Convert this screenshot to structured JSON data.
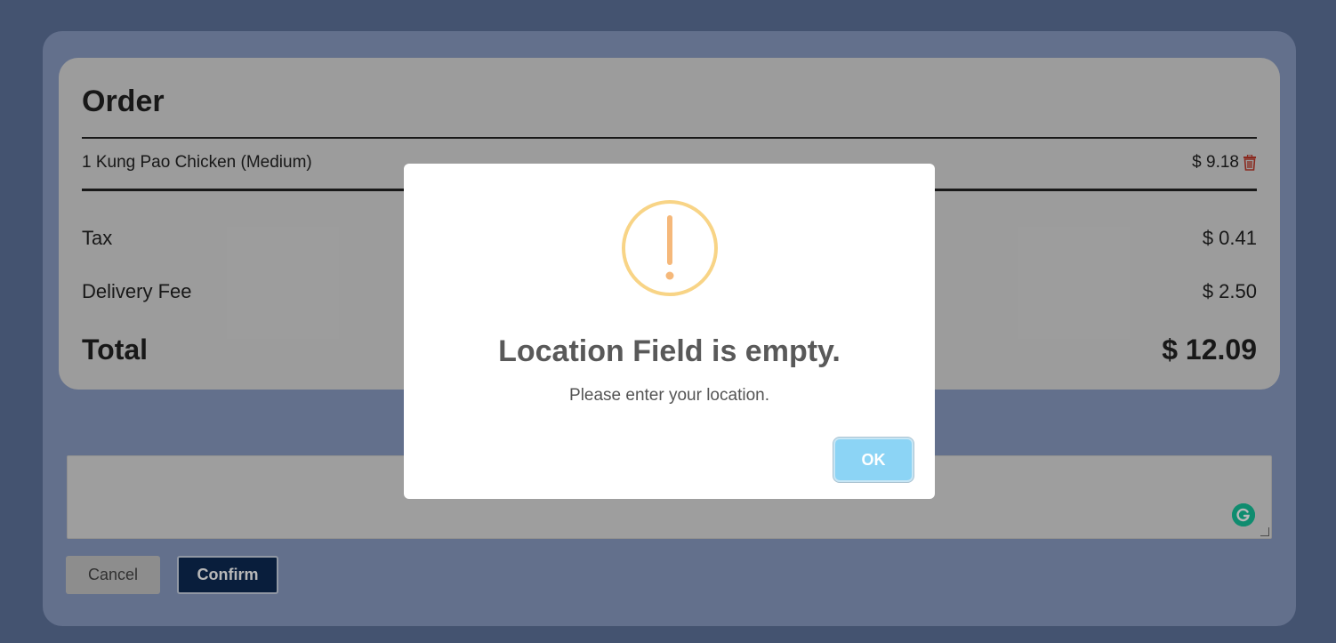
{
  "order": {
    "title": "Order",
    "items": [
      {
        "label": "1 Kung Pao Chicken (Medium)",
        "price": "$ 9.18"
      }
    ],
    "tax_label": "Tax",
    "tax_value": "$ 0.41",
    "fee_label": "Delivery Fee",
    "fee_value": "$ 2.50",
    "total_label": "Total",
    "total_value": "$ 12.09"
  },
  "notes": {
    "value": ""
  },
  "actions": {
    "cancel_label": "Cancel",
    "confirm_label": "Confirm"
  },
  "dialog": {
    "icon": "warning-icon",
    "title": "Location Field is empty.",
    "text": "Please enter your location.",
    "ok_label": "OK"
  },
  "colors": {
    "background": "#5f739c",
    "confirm_button": "#0d2a54",
    "ok_button": "#8cd4f5",
    "warning": "#f8d486",
    "trash": "#c0392b",
    "grammarly": "#15c39a"
  }
}
